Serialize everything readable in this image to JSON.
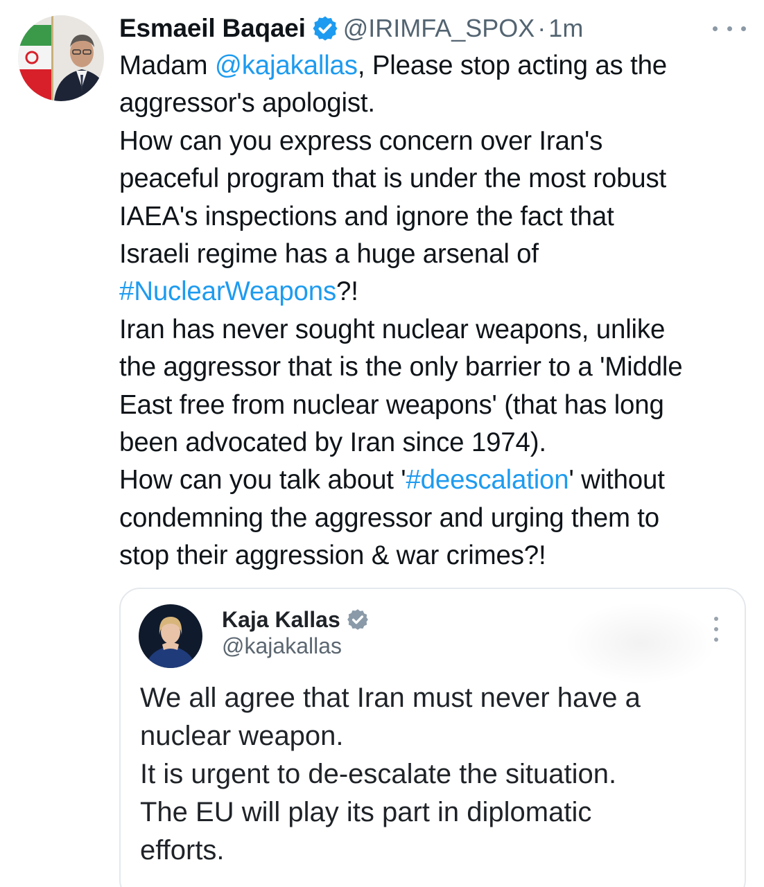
{
  "author": {
    "display_name": "Esmaeil Baqaei",
    "handle": "@IRIMFA_SPOX",
    "separator": "·",
    "time": "1m",
    "verified": true,
    "avatar_icon": "profile-photo-with-iran-flag"
  },
  "tweet": {
    "lines": [
      [
        {
          "t": "Madam "
        },
        {
          "t": "@kajakallas",
          "link": true
        },
        {
          "t": ", Please stop acting as the"
        }
      ],
      [
        {
          "t": "aggressor's apologist."
        }
      ],
      [
        {
          "t": "How can you express concern over Iran's"
        }
      ],
      [
        {
          "t": "peaceful program that is under the most robust"
        }
      ],
      [
        {
          "t": "IAEA's inspections and ignore the fact that"
        }
      ],
      [
        {
          "t": "Israeli regime has a huge arsenal of"
        }
      ],
      [
        {
          "t": "#NuclearWeapons",
          "link": true
        },
        {
          "t": "?!"
        }
      ],
      [
        {
          "t": "Iran has never sought nuclear weapons, unlike"
        }
      ],
      [
        {
          "t": "the aggressor that is the only barrier to a 'Middle"
        }
      ],
      [
        {
          "t": "East free from nuclear weapons' (that has long"
        }
      ],
      [
        {
          "t": "been advocated by Iran since 1974)."
        }
      ],
      [
        {
          "t": "How can you talk about  '"
        },
        {
          "t": "#deescalation",
          "link": true
        },
        {
          "t": "' without"
        }
      ],
      [
        {
          "t": "condemning the aggressor and urging them to"
        }
      ],
      [
        {
          "t": "stop their aggression & war crimes?!"
        }
      ]
    ]
  },
  "quoted": {
    "display_name": "Kaja Kallas",
    "handle": "@kajakallas",
    "verified": true,
    "avatar_icon": "profile-photo",
    "lines": [
      "We all agree that Iran must never have a",
      "nuclear weapon.",
      "It is urgent to de-escalate the situation.",
      "The EU will play its part in diplomatic",
      "efforts."
    ]
  },
  "colors": {
    "link": "#1d9bf0",
    "text": "#0f1419",
    "secondary": "#536471",
    "badge": "#1d9bf0",
    "quote_badge": "#8a9aa8"
  }
}
